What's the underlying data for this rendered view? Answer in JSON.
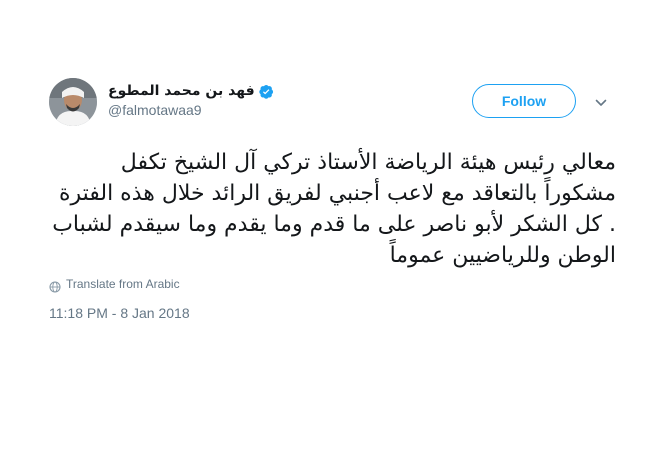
{
  "tweet": {
    "author": {
      "display_name": "فهد بن محمد المطوع",
      "handle": "@falmotawaa9",
      "verified": true
    },
    "follow_label": "Follow",
    "text_lines": [
      "معالي رئيس هيئة الرياضة الأستاذ تركي آل الشيخ تكفل",
      "مشكوراً بالتعاقد مع لاعب أجنبي لفريق الرائد خلال هذه الفترة",
      ". كل الشكر لأبو ناصر على ما قدم وما يقدم وما سيقدم لشباب",
      "الوطن وللرياضيين عموماً"
    ],
    "translate_label": "Translate from Arabic",
    "timestamp": "11:18 PM - 8 Jan 2018"
  },
  "colors": {
    "accent": "#1da1f2",
    "text_primary": "#14171a",
    "text_secondary": "#657786"
  },
  "icons": {
    "verified": "verified-badge-icon",
    "caret": "chevron-down-icon",
    "translate": "globe-icon"
  }
}
